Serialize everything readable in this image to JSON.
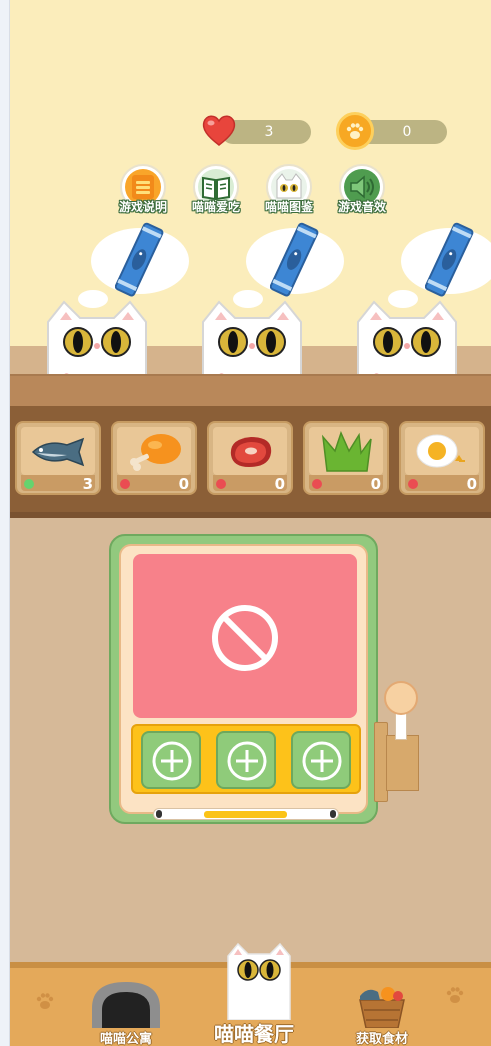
{
  "stats": {
    "lives": "3",
    "coins": "0"
  },
  "menu": [
    {
      "label": "游戏说明",
      "icon": "list-icon",
      "color": "#f9a52a"
    },
    {
      "label": "喵喵爱吃",
      "icon": "book-icon",
      "color": "#4f9c4f"
    },
    {
      "label": "喵喵图鉴",
      "icon": "cat-face-icon",
      "color": "#ffffff"
    },
    {
      "label": "游戏音效",
      "icon": "speaker-icon",
      "color": "#4f9c4f"
    }
  ],
  "customers": [
    {
      "order": "dried-fish-snack"
    },
    {
      "order": "dried-fish-snack"
    },
    {
      "order": "dried-fish-snack"
    }
  ],
  "ingredients": [
    {
      "name": "fish",
      "count": "3",
      "status": "available",
      "status_color": "#66d36e"
    },
    {
      "name": "chicken-leg",
      "count": "0",
      "status": "empty",
      "status_color": "#ea4c52"
    },
    {
      "name": "steak",
      "count": "0",
      "status": "empty",
      "status_color": "#ea4c52"
    },
    {
      "name": "grass",
      "count": "0",
      "status": "empty",
      "status_color": "#ea4c52"
    },
    {
      "name": "fried-egg",
      "count": "0",
      "status": "empty",
      "status_color": "#ea4c52"
    }
  ],
  "cooker": {
    "screen_icon": "prohibited-icon",
    "progress": 0.5
  },
  "nav": [
    {
      "label": "喵喵公寓",
      "icon": "cat-house-icon"
    },
    {
      "label": "喵喵餐厅",
      "icon": "cat-icon",
      "active": true
    },
    {
      "label": "获取食材",
      "icon": "food-basket-icon"
    }
  ],
  "colors": {
    "sky": "#fbedbb",
    "counter": "#8b5f37",
    "screen": "#f7818a",
    "tray": "#fdc21a",
    "add_slot": "#8fcb7a"
  }
}
